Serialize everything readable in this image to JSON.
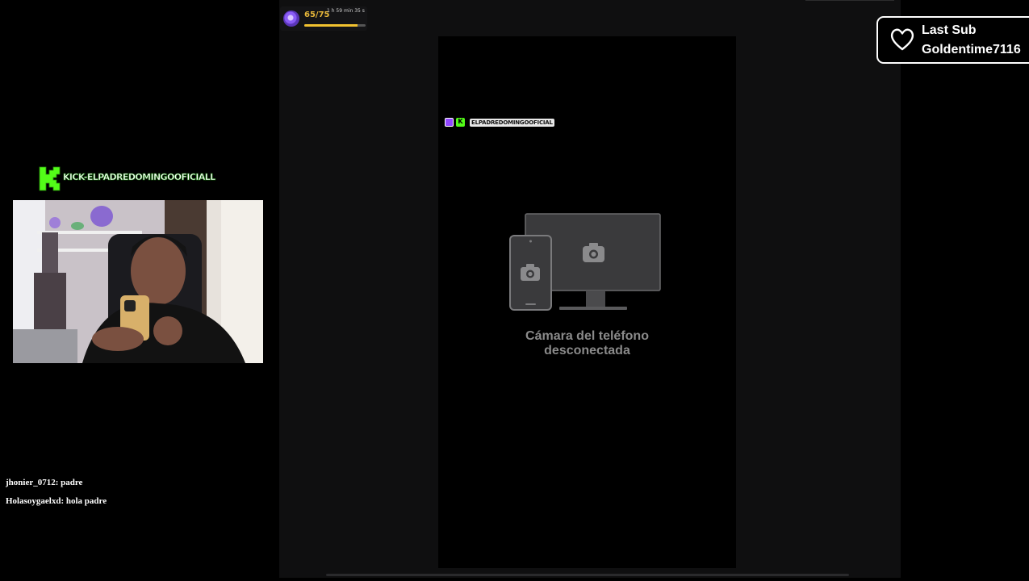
{
  "goal": {
    "count": "65/75",
    "time_left": "1 h 59 min 35 s",
    "progress": 0.87,
    "icon": "sub-goal-icon"
  },
  "kick": {
    "handle": "KICK-ELPADREDOMINGOOFICIALL",
    "icon": "kick-logo-icon",
    "color": "#53fc18"
  },
  "phone": {
    "handle": "ELPADREDOMINGOOFICIAL",
    "status_line1": "Cámara del teléfono",
    "status_line2": "desconectada"
  },
  "chat": {
    "messages": [
      {
        "text": "jhonier_0712: padre"
      },
      {
        "text": "Holasoygaelxd: hola padre"
      }
    ]
  },
  "last_sub": {
    "title": "Last Sub",
    "name": "Goldentime7116",
    "icon": "heart-icon"
  }
}
